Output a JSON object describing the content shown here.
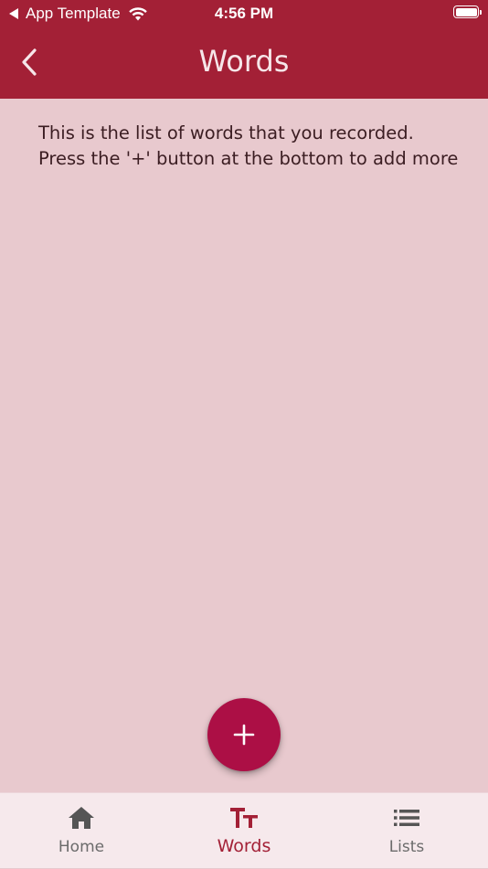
{
  "status_bar": {
    "back_app_label": "App Template",
    "time": "4:56 PM"
  },
  "header": {
    "title": "Words",
    "back_icon": "chevron-left-icon"
  },
  "content": {
    "intro_lines": [
      "This is the list of words that you recorded.",
      "Press the '+' button at the bottom to add more"
    ]
  },
  "fab": {
    "symbol": "+",
    "icon": "plus-icon"
  },
  "tabs": [
    {
      "label": "Home",
      "icon": "home-icon",
      "active": false
    },
    {
      "label": "Words",
      "icon": "text-size-icon",
      "active": true
    },
    {
      "label": "Lists",
      "icon": "list-icon",
      "active": false
    }
  ],
  "colors": {
    "header": "#a32036",
    "background": "#e8c9ce",
    "fab": "#ac0f45",
    "tab_active": "#a32036",
    "tab_inactive": "#6b6b6b",
    "tabbar": "#f6e9ec"
  }
}
